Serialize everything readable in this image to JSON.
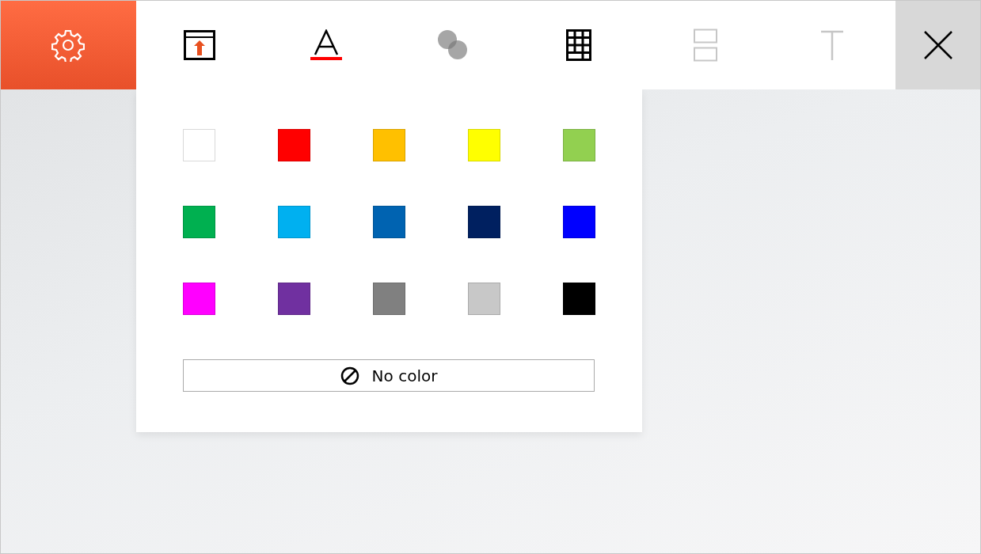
{
  "toolbar": {
    "settings": {
      "selected": true
    },
    "tools": [
      {
        "kind": "insert",
        "disabled": false,
        "selected": false
      },
      {
        "kind": "font-color",
        "disabled": false,
        "selected": false
      },
      {
        "kind": "fill",
        "disabled": false,
        "selected": false
      },
      {
        "kind": "table",
        "disabled": false,
        "selected": false
      },
      {
        "kind": "split",
        "disabled": true,
        "selected": false
      },
      {
        "kind": "text",
        "disabled": true,
        "selected": false
      }
    ]
  },
  "palette": {
    "swatches": [
      {
        "color": "#ffffff"
      },
      {
        "color": "#ff0000"
      },
      {
        "color": "#ffc000"
      },
      {
        "color": "#ffff00"
      },
      {
        "color": "#92d050"
      },
      {
        "color": "#00b050"
      },
      {
        "color": "#00b0f0"
      },
      {
        "color": "#0063b1"
      },
      {
        "color": "#002060"
      },
      {
        "color": "#0000ff"
      },
      {
        "color": "#ff00ff"
      },
      {
        "color": "#7030a0"
      },
      {
        "color": "#808080"
      },
      {
        "color": "#c8c8c8"
      },
      {
        "color": "#000000"
      }
    ],
    "no_color_button": {
      "label": "No color"
    }
  }
}
